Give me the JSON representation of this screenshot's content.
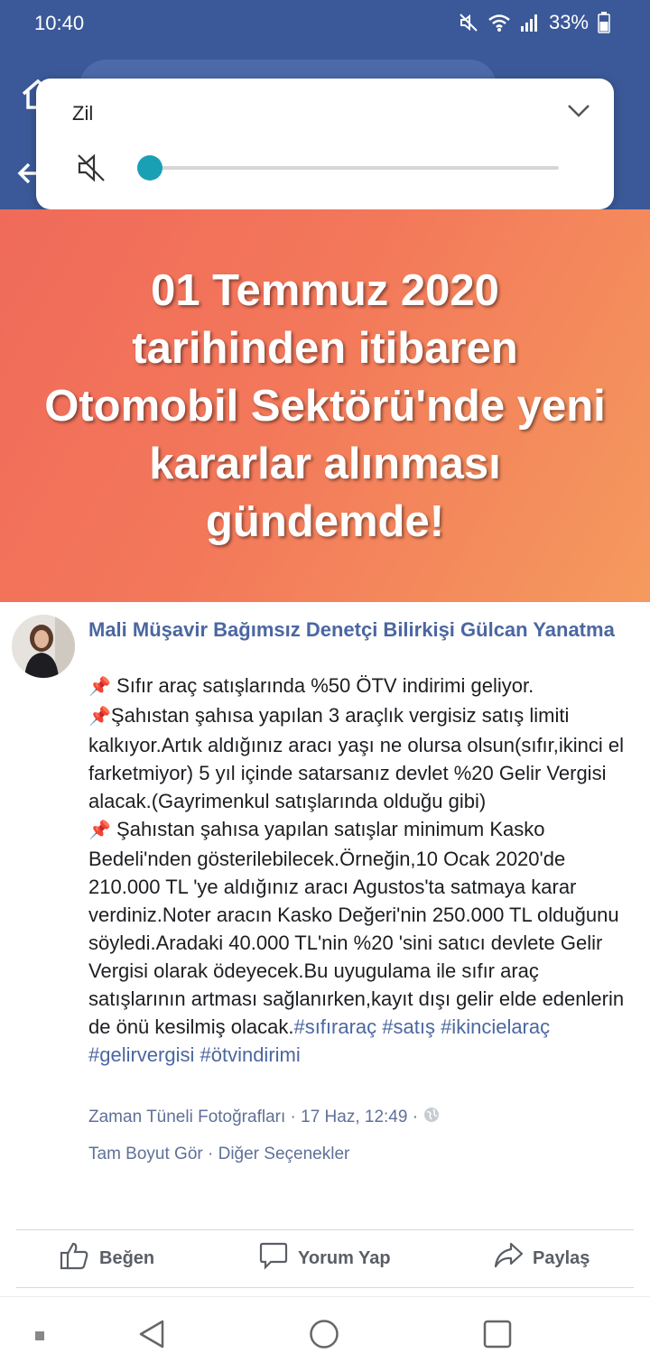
{
  "status_bar": {
    "time": "10:40",
    "battery": "33%"
  },
  "volume_popup": {
    "label": "Zil",
    "level": 0
  },
  "banner": {
    "lines": [
      "01 Temmuz 2020",
      "tarihinden itibaren",
      "Otomobil Sektörü'nde yeni",
      "kararlar alınması",
      "gündemde!"
    ]
  },
  "post": {
    "author": "Mali Müşavir Bağımsız Denetçi Bilirkişi Gülcan Yanatma",
    "paragraphs": [
      "Sıfır araç satışlarında %50 ÖTV indirimi geliyor.",
      "Şahıstan şahısa yapılan 3 araçlık vergisiz satış limiti kalkıyor.Artık aldığınız aracı yaşı ne olursa olsun(sıfır,ikinci el farketmiyor) 5 yıl içinde satarsanız devlet %20 Gelir Vergisi alacak.(Gayrimenkul satışlarında olduğu gibi)",
      "Şahıstan şahısa yapılan satışlar minimum Kasko Bedeli'nden gösterilebilecek.Örneğin,10 Ocak 2020'de 210.000 TL 'ye aldığınız aracı Agustos'ta satmaya karar verdiniz.Noter aracın Kasko Değeri'nin 250.000 TL olduğunu söyledi.Aradaki 40.000 TL'nin %20 'sini satıcı devlete Gelir Vergisi olarak ödeyecek.Bu uyugulama ile sıfır araç satışlarının artması sağlanırken,kayıt dışı gelir elde edenlerin de önü kesilmiş olacak."
    ],
    "hashtags": "#sıfıraraç #satış #ikincielaraç #gelirvergisi #ötvindirimi",
    "meta": "Zaman Tüneli Fotoğrafları · 17 Haz, 12:49 ·",
    "links": "Tam Boyut Gör · Diğer Seçenekler"
  },
  "actions": {
    "like": "Beğen",
    "comment": "Yorum Yap",
    "share": "Paylaş"
  },
  "colors": {
    "fb_blue": "#3b5998",
    "link": "#4b67a1",
    "slider": "#1aa0b5"
  }
}
